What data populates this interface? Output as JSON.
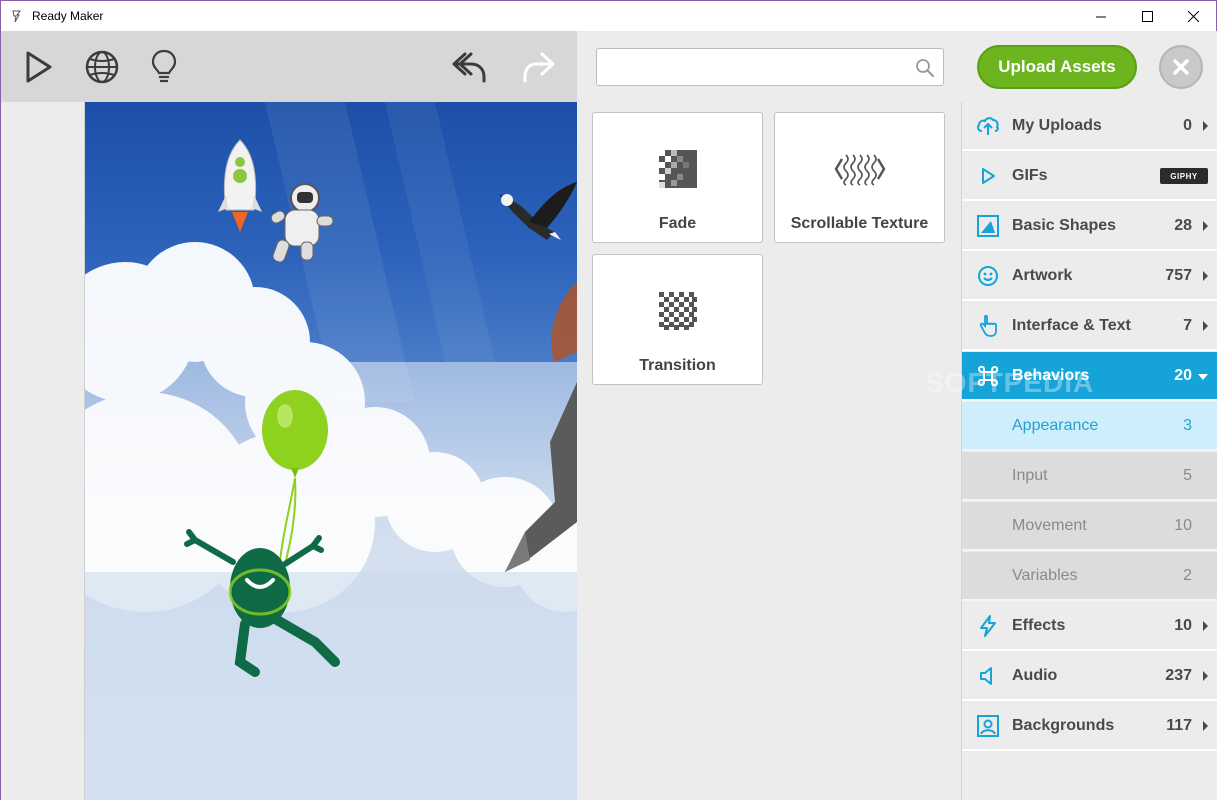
{
  "window": {
    "title": "Ready Maker",
    "controls": [
      "minimize",
      "maximize",
      "close"
    ]
  },
  "toolbar": {
    "icons": [
      "play-icon",
      "globe-icon",
      "lightbulb-icon",
      "undo-icon",
      "redo-icon"
    ]
  },
  "search": {
    "value": "",
    "placeholder": ""
  },
  "upload_button": {
    "label": "Upload Assets"
  },
  "cards": [
    {
      "label": "Fade",
      "icon": "fade-icon"
    },
    {
      "label": "Scrollable Texture",
      "icon": "scrollable-texture-icon"
    },
    {
      "label": "Transition",
      "icon": "transition-icon"
    }
  ],
  "categories": [
    {
      "label": "My Uploads",
      "count": "0",
      "icon": "cloud-upload-icon"
    },
    {
      "label": "GIFs",
      "count": "",
      "icon": "play-outline-icon",
      "badge": "GIPHY"
    },
    {
      "label": "Basic Shapes",
      "count": "28",
      "icon": "shapes-icon"
    },
    {
      "label": "Artwork",
      "count": "757",
      "icon": "smiley-icon"
    },
    {
      "label": "Interface & Text",
      "count": "7",
      "icon": "hand-pointer-icon"
    },
    {
      "label": "Behaviors",
      "count": "20",
      "icon": "command-icon",
      "active": true
    },
    {
      "label": "Appearance",
      "count": "3",
      "sub": true,
      "selected": true
    },
    {
      "label": "Input",
      "count": "5",
      "sub": true
    },
    {
      "label": "Movement",
      "count": "10",
      "sub": true
    },
    {
      "label": "Variables",
      "count": "2",
      "sub": true
    },
    {
      "label": "Effects",
      "count": "10",
      "icon": "lightning-icon"
    },
    {
      "label": "Audio",
      "count": "237",
      "icon": "speaker-icon"
    },
    {
      "label": "Backgrounds",
      "count": "117",
      "icon": "image-frame-icon"
    }
  ],
  "watermark": "SOFTPEDIA",
  "colors": {
    "accent_blue": "#16a4d8",
    "upload_green": "#6cb51f",
    "selected_sub_bg": "#cdeefa"
  }
}
